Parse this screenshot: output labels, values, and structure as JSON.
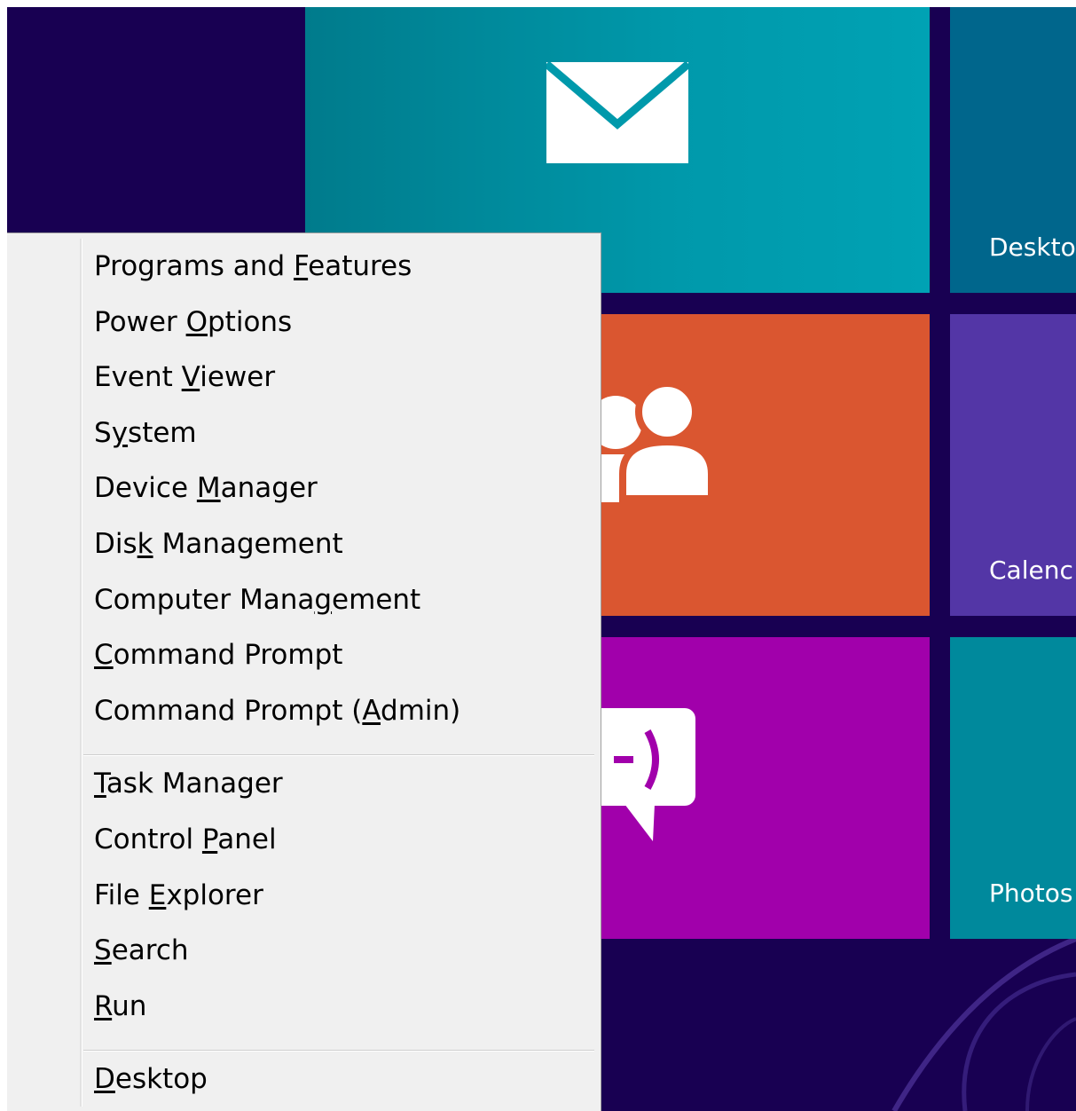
{
  "tiles": {
    "mail": {
      "icon": "mail-icon",
      "color": "#0099ab"
    },
    "desktop": {
      "label": "Deskto",
      "color": "#00668c"
    },
    "people": {
      "icon": "people-icon",
      "color": "#da5630"
    },
    "calendar": {
      "label": "Calenc",
      "color": "#5336a6"
    },
    "messaging": {
      "icon": "messaging-icon",
      "color": "#a100ab"
    },
    "photos": {
      "label": "Photos",
      "color": "#00899c"
    }
  },
  "background_color": "#180052",
  "context_menu": {
    "groups": [
      [
        {
          "label": "Programs and Features",
          "access_key": "F"
        },
        {
          "label": "Power Options",
          "access_key": "O"
        },
        {
          "label": "Event Viewer",
          "access_key": "V"
        },
        {
          "label": "System",
          "access_key": "y"
        },
        {
          "label": "Device Manager",
          "access_key": "M"
        },
        {
          "label": "Disk Management",
          "access_key": "k"
        },
        {
          "label": "Computer Management",
          "access_key": "g"
        },
        {
          "label": "Command Prompt",
          "access_key": "C"
        },
        {
          "label": "Command Prompt (Admin)",
          "access_key": "A"
        }
      ],
      [
        {
          "label": "Task Manager",
          "access_key": "T"
        },
        {
          "label": "Control Panel",
          "access_key": "P"
        },
        {
          "label": "File Explorer",
          "access_key": "E"
        },
        {
          "label": "Search",
          "access_key": "S"
        },
        {
          "label": "Run",
          "access_key": "R"
        }
      ],
      [
        {
          "label": "Desktop",
          "access_key": "D"
        }
      ]
    ]
  }
}
